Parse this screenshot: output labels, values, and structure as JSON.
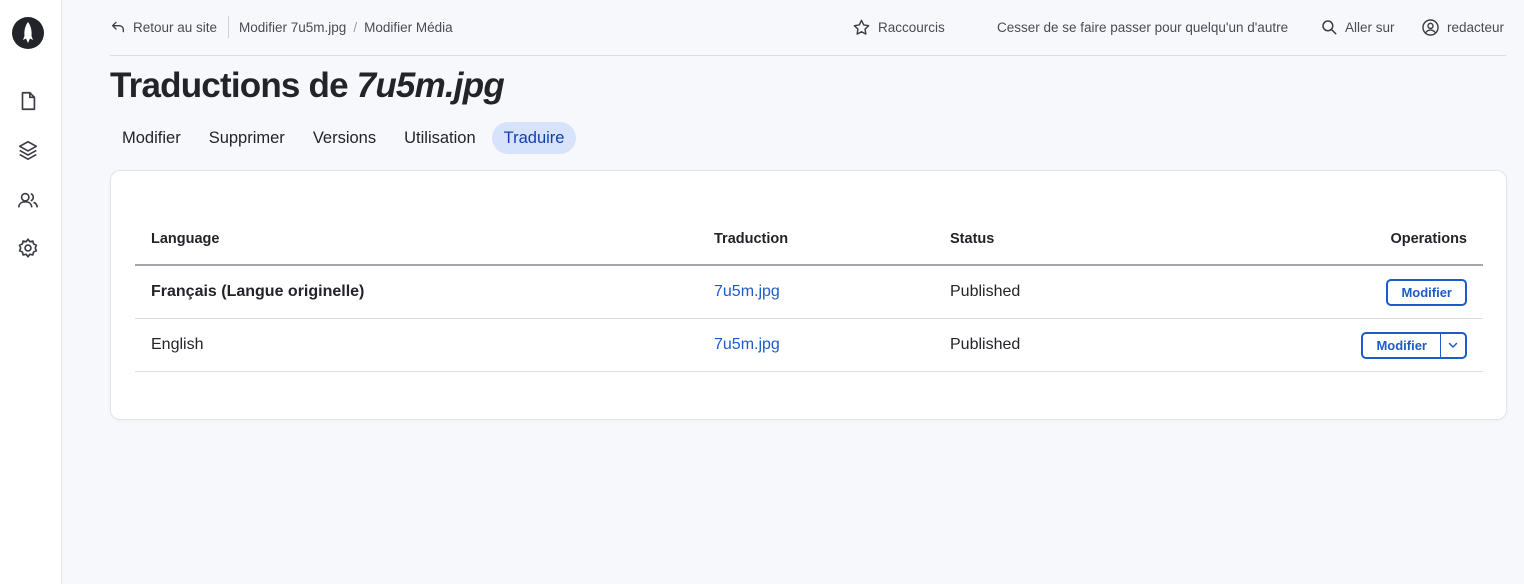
{
  "topbar": {
    "back_label": "Retour au site",
    "breadcrumb": [
      "Modifier 7u5m.jpg",
      "Modifier Média"
    ],
    "shortcuts_label": "Raccourcis",
    "impersonate_label": "Cesser de se faire passer pour quelqu'un d'autre",
    "goto_label": "Aller sur",
    "user_label": "redacteur"
  },
  "page": {
    "title_prefix": "Traductions de ",
    "title_file": "7u5m.jpg"
  },
  "tabs": [
    {
      "label": "Modifier",
      "active": false
    },
    {
      "label": "Supprimer",
      "active": false
    },
    {
      "label": "Versions",
      "active": false
    },
    {
      "label": "Utilisation",
      "active": false
    },
    {
      "label": "Traduire",
      "active": true
    }
  ],
  "table": {
    "headers": {
      "language": "Language",
      "translation": "Traduction",
      "status": "Status",
      "operations": "Operations"
    },
    "rows": [
      {
        "language": "Français (Langue originelle)",
        "translation": "7u5m.jpg",
        "status": "Published",
        "operation": "Modifier"
      },
      {
        "language": "English",
        "translation": "7u5m.jpg",
        "status": "Published",
        "operation": "Modifier"
      }
    ]
  },
  "colors": {
    "accent": "#1c5cc9",
    "active_tab_bg": "#d7e2fb",
    "sidebar_bg": "#ffffff",
    "page_bg": "#f7f8fc"
  },
  "icons": {
    "logo": "rocket-logo-icon",
    "sidebar": [
      "content-file-icon",
      "structure-layers-icon",
      "people-icon",
      "settings-gear-icon"
    ],
    "back": "back-arrow-icon",
    "shortcuts": "star-icon",
    "goto": "search-icon",
    "user": "user-circle-icon",
    "dropdown": "chevron-down-icon"
  }
}
